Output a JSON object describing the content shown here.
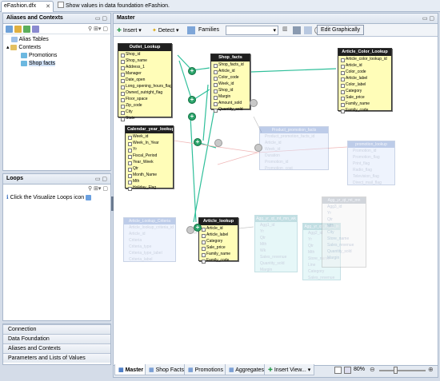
{
  "top": {
    "file_tab": "eFashion.dfx",
    "show_values_label": "Show values in data foundation eFashion."
  },
  "left": {
    "aliases_title": "Aliases and Contexts",
    "tree": {
      "alias_tables": "Alias Tables",
      "contexts": "Contexts",
      "promotions": "Promotions",
      "shop_facts": "Shop facts"
    },
    "loops_title": "Loops",
    "loops_hint": "Click the Visualize Loops icon",
    "accordion": [
      "Connection",
      "Data Foundation",
      "Aliases and Contexts",
      "Parameters and Lists of Values"
    ]
  },
  "master": {
    "title": "Master",
    "toolbar": {
      "insert": "Insert",
      "detect": "Detect",
      "families_label": "Families",
      "edit_graphically": "Edit Graphically"
    },
    "tables": [
      {
        "name": "Outlet_Lookup",
        "cols": [
          "Shop_id",
          "Shop_name",
          "Address_1",
          "Manager",
          "Date_open",
          "Long_opening_hours_flag",
          "Owned_outright_flag",
          "Floor_space",
          "Zip_code",
          "City",
          "State"
        ]
      },
      {
        "name": "Shop_facts",
        "cols": [
          "Shop_facts_id",
          "Article_id",
          "Color_code",
          "Week_id",
          "Shop_id",
          "Margin",
          "Amount_sold",
          "Quantity_sold"
        ]
      },
      {
        "name": "Article_Color_Lookup",
        "cols": [
          "Article_color_lookup_id",
          "Article_id",
          "Color_code",
          "Article_label",
          "Color_label",
          "Category",
          "Sale_price",
          "Family_name",
          "Family_code"
        ]
      },
      {
        "name": "Calendar_year_lookup",
        "cols": [
          "Week_id",
          "Week_In_Year",
          "Yr",
          "Fiscal_Period",
          "Year_Week",
          "Qtr",
          "Month_Name",
          "Mth",
          "Holiday_Flag"
        ]
      },
      {
        "name": "Article_lookup",
        "cols": [
          "Article_id",
          "Article_label",
          "Category",
          "Sale_price",
          "Family_name",
          "Family_code"
        ]
      }
    ],
    "ghost_tables": [
      {
        "name": "Product_promotion_facts",
        "cols": [
          "Product_promotion_facts_id",
          "Article_id",
          "Week_id",
          "Duration",
          "Promotion_id",
          "Promotion_cost"
        ]
      },
      {
        "name": "promotion_lookup",
        "cols": [
          "Promotion_id",
          "Promotion_flag",
          "Print_flag",
          "Radio_flag",
          "Television_flag",
          "Direct_mail_flag"
        ]
      },
      {
        "name": "Article_Lookup_Criteria",
        "cols": [
          "Article_lookup_criteria_id",
          "Article_id",
          "Criteria",
          "Criteria_type",
          "Criteria_type_label",
          "Criteria_label"
        ]
      },
      {
        "name": "Agg_yr_qt_mt_mn_wk",
        "cols": [
          "Agg1_id",
          "Yr",
          "Qtr",
          "Mth",
          "Wk",
          "Sales_revenue",
          "Quantity_sold",
          "Margin"
        ]
      },
      {
        "name": "Agg_yr_qt_rn_st_ln",
        "cols": [
          "Agg2_id",
          "Yr",
          "Qtr",
          "Mth",
          "Store_name",
          "Line",
          "Category",
          "Sales_revenue"
        ]
      },
      {
        "name": "Agg_yr_qt_mt_mn",
        "cols": [
          "Agg3_id",
          "Yr",
          "Qtr",
          "Mth",
          "City",
          "Store_name",
          "Sales_revenue",
          "Quantity_sold",
          "Margin"
        ]
      }
    ],
    "bottom_tabs": [
      "Master",
      "Shop Facts",
      "Promotions",
      "Aggregates",
      "Insert View..."
    ],
    "zoom": "80%"
  },
  "colors": {
    "table_fill": "#fffdb8",
    "join_line": "#2fbf9a",
    "node": "#2aa36a"
  }
}
